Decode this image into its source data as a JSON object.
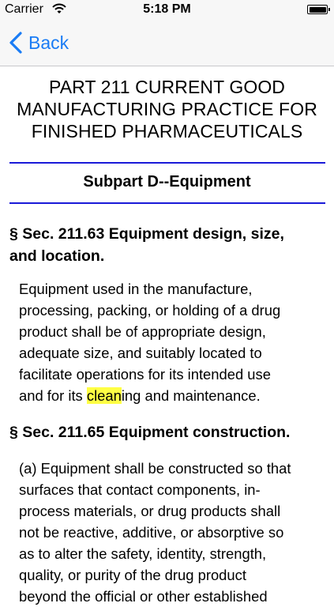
{
  "status_bar": {
    "carrier": "Carrier",
    "time": "5:18 PM"
  },
  "nav": {
    "back_label": "Back",
    "tint": "#1a7cf5"
  },
  "content": {
    "title_lines": [
      "PART 211 CURRENT GOOD",
      "MANUFACTURING PRACTICE FOR",
      "FINISHED PHARMACEUTICALS"
    ],
    "subpart": "Subpart D--Equipment",
    "sections": [
      {
        "heading_lines": [
          "§ Sec. 211.63 Equipment design, size,",
          "and location."
        ],
        "paragraph": {
          "lines": [
            "Equipment used in the manufacture,",
            "processing, packing, or holding of a drug",
            "product shall be of appropriate design,",
            "adequate size, and suitably located to",
            "facilitate operations for its intended use"
          ],
          "last_line_before": "and for its ",
          "highlight": "clean",
          "last_line_after": "ing and maintenance.",
          "highlight_color": "#ffff44"
        }
      },
      {
        "heading_lines": [
          "§ Sec. 211.65 Equipment construction."
        ],
        "paragraph": {
          "lines": [
            "(a) Equipment shall be constructed so that",
            "surfaces that contact components, in-",
            "process materials, or drug products shall",
            "not be reactive, additive, or absorptive so",
            "as to alter the safety, identity, strength,",
            "quality, or purity of the drug product",
            "beyond the official or other established"
          ]
        }
      }
    ],
    "rule_color": "#1a1ad8"
  }
}
